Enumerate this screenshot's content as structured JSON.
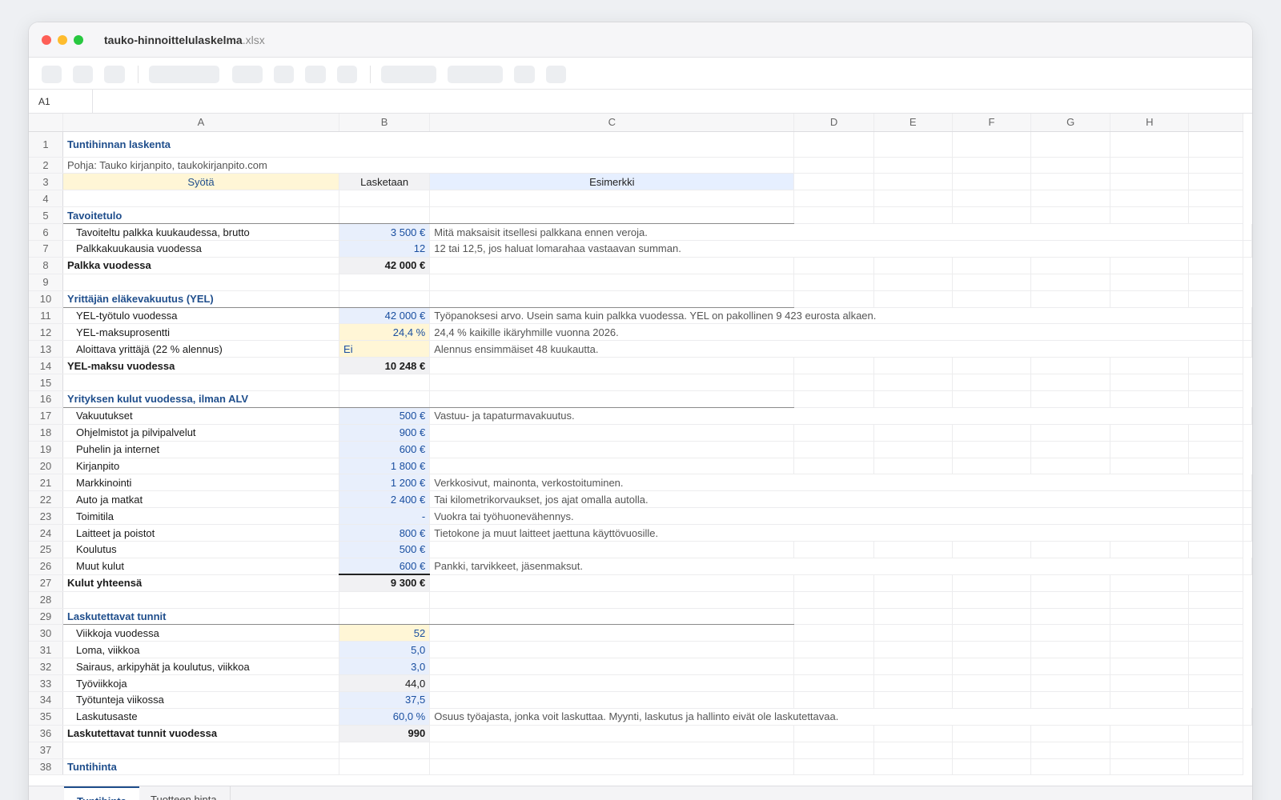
{
  "window": {
    "file_name": "tauko-hinnoittelulaskelma",
    "file_ext": ".xlsx"
  },
  "formula_bar": {
    "cell_ref": "A1"
  },
  "columns": [
    "A",
    "B",
    "C",
    "D",
    "E",
    "F",
    "G",
    "H"
  ],
  "sheet": {
    "title": "Tuntihinnan laskenta",
    "source": "Pohja: Tauko kirjanpito, taukokirjanpito.com",
    "legend_input": "Syötä",
    "legend_calc": "Lasketaan",
    "legend_example": "Esimerkki",
    "sec1": "Tavoitetulo",
    "r6": {
      "label": "Tavoiteltu palkka kuukaudessa, brutto",
      "value": "3 500 €",
      "note": "Mitä maksaisit itsellesi palkkana ennen veroja."
    },
    "r7": {
      "label": "Palkkakuukausia vuodessa",
      "value": "12",
      "note": "12 tai 12,5, jos haluat lomarahaa vastaavan summan."
    },
    "r8": {
      "label": "Palkka vuodessa",
      "value": "42 000 €"
    },
    "sec2": "Yrittäjän eläkevakuutus (YEL)",
    "r11": {
      "label": "YEL-työtulo vuodessa",
      "value": "42 000 €",
      "note": "Työpanoksesi arvo. Usein sama kuin palkka vuodessa. YEL on pakollinen 9 423 eurosta alkaen."
    },
    "r12": {
      "label": "YEL-maksuprosentti",
      "value": "24,4 %",
      "note": "24,4 % kaikille ikäryhmille vuonna 2026."
    },
    "r13": {
      "label": "Aloittava yrittäjä (22 % alennus)",
      "value": "Ei",
      "note": "Alennus ensimmäiset 48 kuukautta."
    },
    "r14": {
      "label": "YEL-maksu vuodessa",
      "value": "10 248 €"
    },
    "sec3": "Yrityksen kulut vuodessa, ilman ALV",
    "r17": {
      "label": "Vakuutukset",
      "value": "500 €",
      "note": "Vastuu- ja tapaturmavakuutus."
    },
    "r18": {
      "label": "Ohjelmistot ja pilvipalvelut",
      "value": "900 €"
    },
    "r19": {
      "label": "Puhelin ja internet",
      "value": "600 €"
    },
    "r20": {
      "label": "Kirjanpito",
      "value": "1 800 €"
    },
    "r21": {
      "label": "Markkinointi",
      "value": "1 200 €",
      "note": "Verkkosivut, mainonta, verkostoituminen."
    },
    "r22": {
      "label": "Auto ja matkat",
      "value": "2 400 €",
      "note": "Tai kilometrikorvaukset, jos ajat omalla autolla."
    },
    "r23": {
      "label": "Toimitila",
      "value": "-",
      "note": "Vuokra tai työhuonevähennys."
    },
    "r24": {
      "label": "Laitteet ja poistot",
      "value": "800 €",
      "note": "Tietokone ja muut laitteet jaettuna käyttövuosille."
    },
    "r25": {
      "label": "Koulutus",
      "value": "500 €"
    },
    "r26": {
      "label": "Muut kulut",
      "value": "600 €",
      "note": "Pankki, tarvikkeet, jäsenmaksut."
    },
    "r27": {
      "label": "Kulut yhteensä",
      "value": "9 300 €"
    },
    "sec4": "Laskutettavat tunnit",
    "r30": {
      "label": "Viikkoja vuodessa",
      "value": "52"
    },
    "r31": {
      "label": "Loma, viikkoa",
      "value": "5,0"
    },
    "r32": {
      "label": "Sairaus, arkipyhät ja koulutus, viikkoa",
      "value": "3,0"
    },
    "r33": {
      "label": "Työviikkoja",
      "value": "44,0"
    },
    "r34": {
      "label": "Työtunteja viikossa",
      "value": "37,5"
    },
    "r35": {
      "label": "Laskutusaste",
      "value": "60,0 %",
      "note": "Osuus työajasta, jonka voit laskuttaa. Myynti, laskutus ja hallinto eivät ole laskutettavaa."
    },
    "r36": {
      "label": "Laskutettavat tunnit vuodessa",
      "value": "990"
    },
    "sec5": "Tuntihinta"
  },
  "tabs": [
    "Tuntihinta",
    "Tuotteen hinta"
  ],
  "colors": {
    "accent": "#1f4e8c",
    "input_fill": "#e8effc",
    "yellow_fill": "#fff6d6"
  }
}
